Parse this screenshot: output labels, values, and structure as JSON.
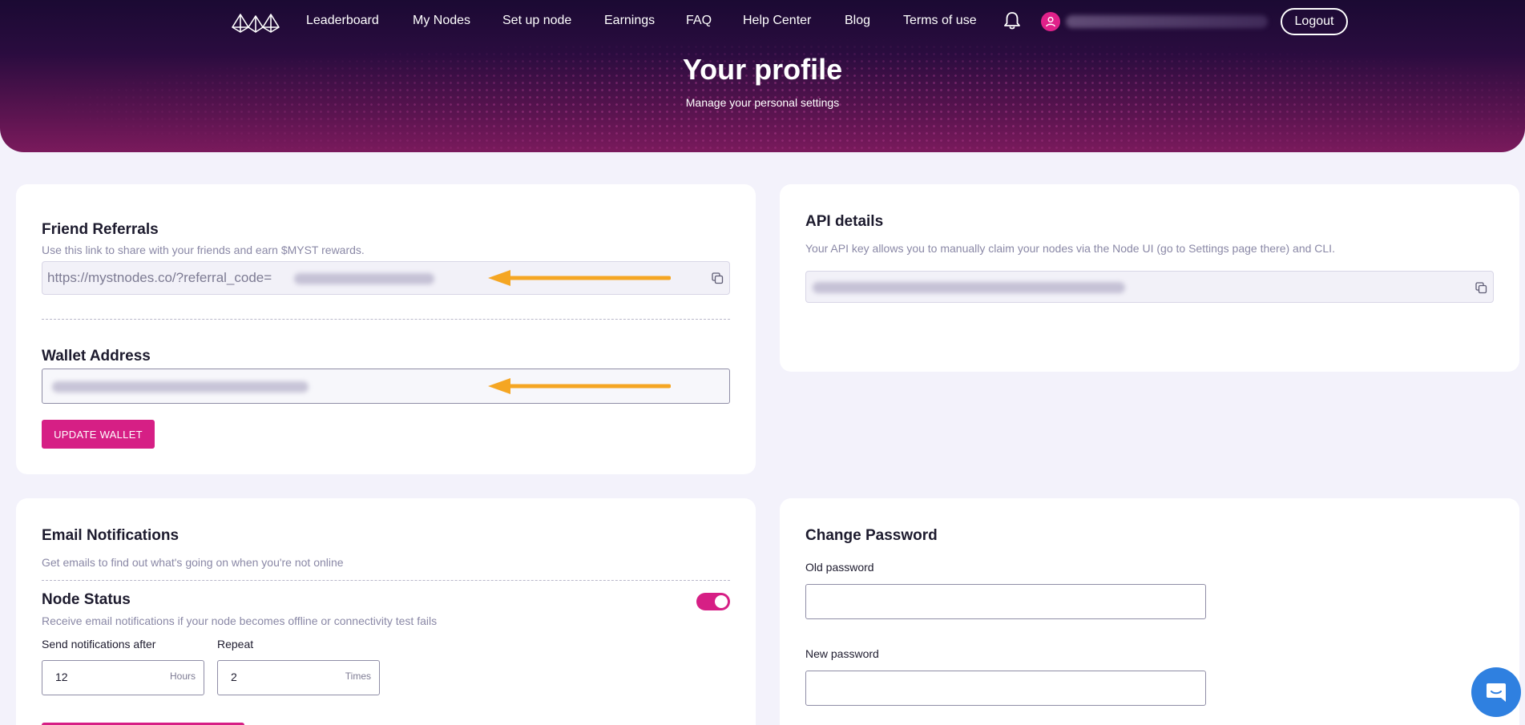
{
  "nav": {
    "links": [
      "Leaderboard",
      "My Nodes",
      "Set up node",
      "Earnings",
      "FAQ",
      "Help Center",
      "Blog",
      "Terms of use"
    ],
    "logout_label": "Logout"
  },
  "hero": {
    "title": "Your profile",
    "subtitle": "Manage your personal settings"
  },
  "referrals": {
    "title": "Friend Referrals",
    "description": "Use this link to share with your friends and earn $MYST rewards.",
    "link_prefix": "https://mystnodes.co/?referral_code="
  },
  "wallet": {
    "title": "Wallet Address",
    "update_label": "UPDATE WALLET"
  },
  "api": {
    "title": "API details",
    "description": "Your API key allows you to manually claim your nodes via the Node UI (go to Settings page there) and CLI."
  },
  "notifications": {
    "title": "Email Notifications",
    "description": "Get emails to find out what's going on when you're not online",
    "node_status": {
      "title": "Node Status",
      "description": "Receive email notifications if your node becomes offline or connectivity test fails",
      "enabled": true
    },
    "send_after": {
      "label": "Send notifications after",
      "value": "12",
      "unit": "Hours"
    },
    "repeat": {
      "label": "Repeat",
      "value": "2",
      "unit": "Times"
    }
  },
  "password": {
    "title": "Change Password",
    "old_label": "Old password",
    "new_label": "New password"
  },
  "colors": {
    "accent": "#d61f85",
    "arrow": "#f5a623",
    "header_dark": "#1b0a33",
    "chat": "#2f80e0"
  },
  "icons": [
    "logo-icon",
    "bell-icon",
    "user-icon",
    "copy-icon",
    "arrow-left-icon",
    "chat-icon"
  ]
}
